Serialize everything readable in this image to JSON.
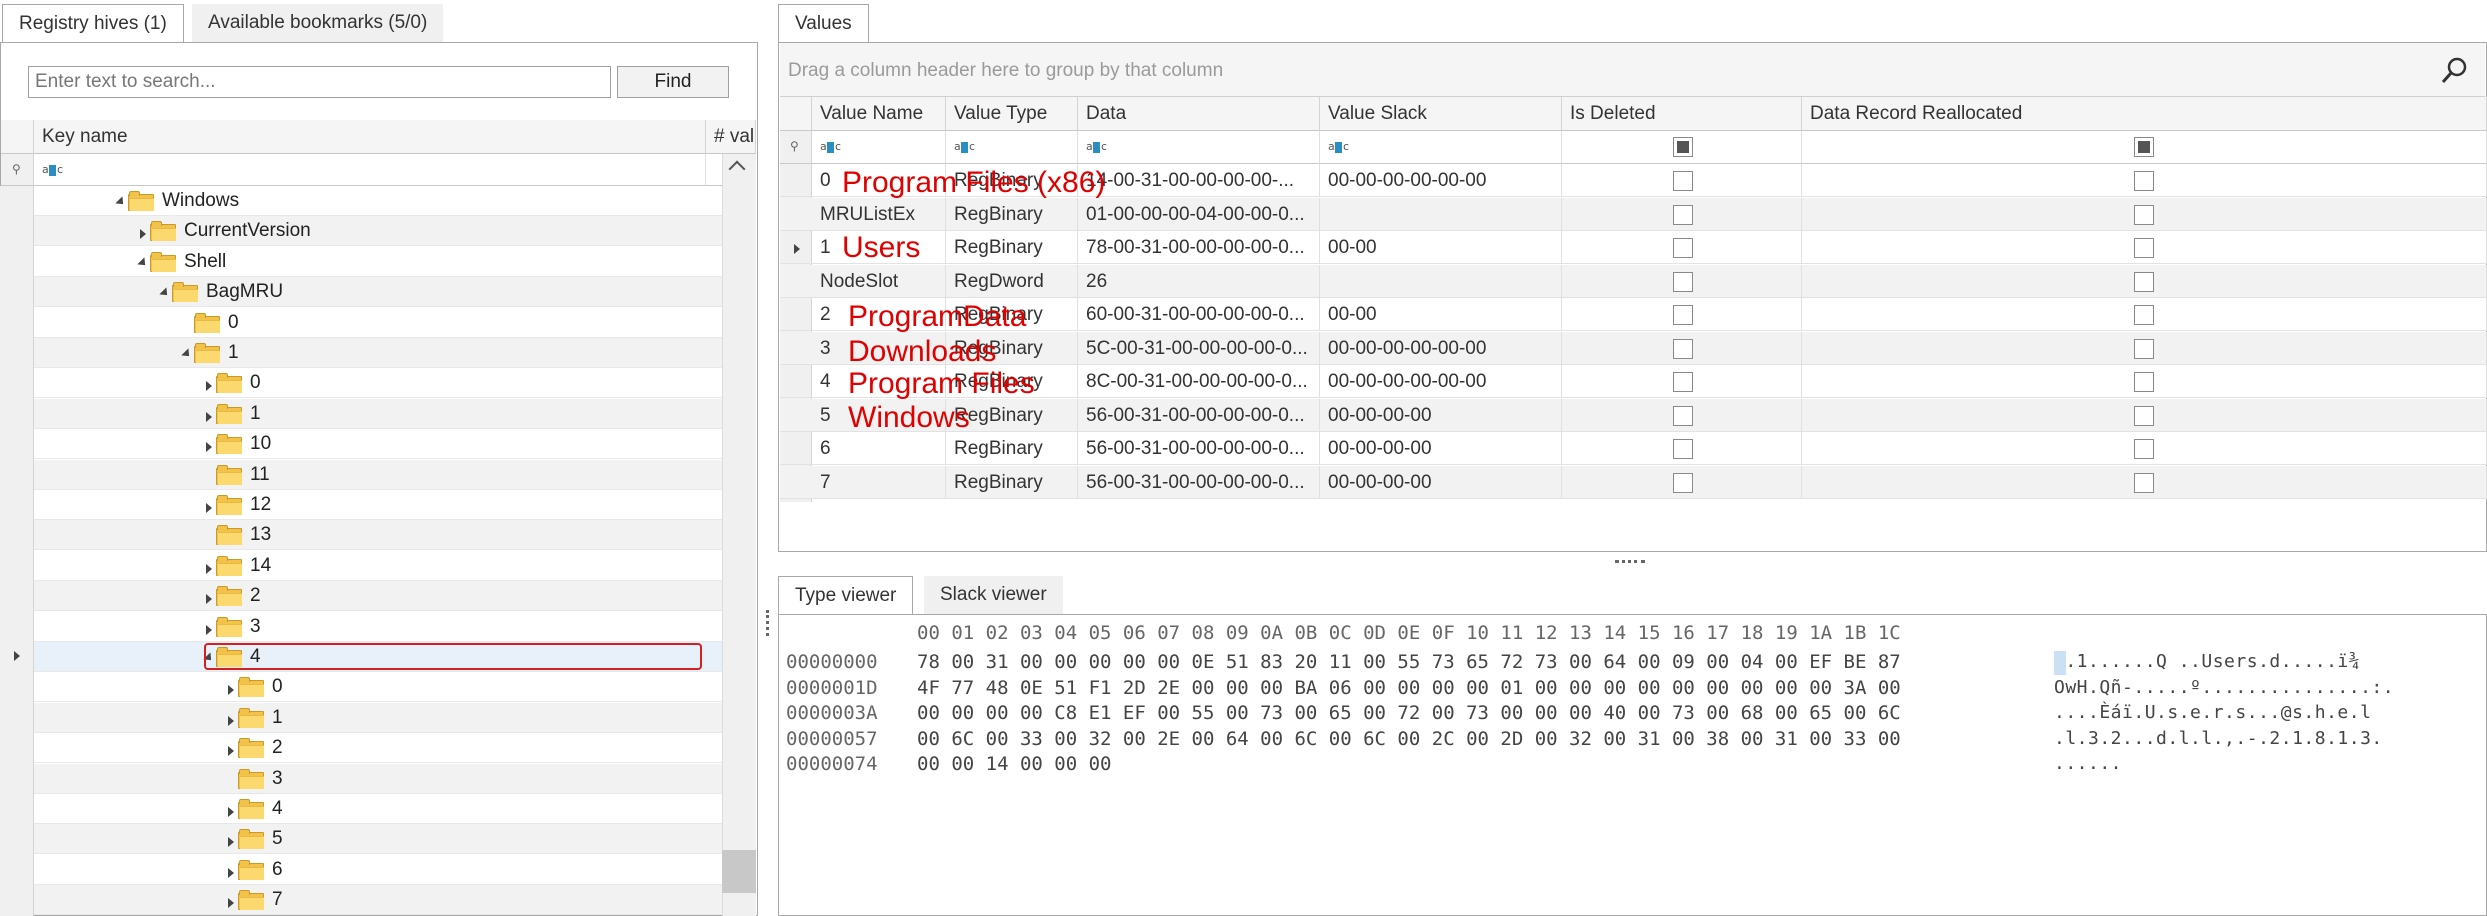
{
  "left_tabs": [
    "Registry hives (1)",
    "Available bookmarks (5/0)"
  ],
  "search": {
    "placeholder": "Enter text to search...",
    "find_label": "Find"
  },
  "tree_columns": {
    "key_name": "Key name",
    "values": "# val"
  },
  "tree_rows": [
    {
      "label": "Windows",
      "level": 0,
      "expander": "expanded"
    },
    {
      "label": "CurrentVersion",
      "level": 1,
      "expander": "collapsed"
    },
    {
      "label": "Shell",
      "level": 1,
      "expander": "expanded"
    },
    {
      "label": "BagMRU",
      "level": 2,
      "expander": "expanded"
    },
    {
      "label": "0",
      "level": 3,
      "expander": "none"
    },
    {
      "label": "1",
      "level": 3,
      "expander": "expanded"
    },
    {
      "label": "0",
      "level": 4,
      "expander": "collapsed"
    },
    {
      "label": "1",
      "level": 4,
      "expander": "collapsed"
    },
    {
      "label": "10",
      "level": 4,
      "expander": "collapsed"
    },
    {
      "label": "11",
      "level": 4,
      "expander": "none"
    },
    {
      "label": "12",
      "level": 4,
      "expander": "collapsed"
    },
    {
      "label": "13",
      "level": 4,
      "expander": "none"
    },
    {
      "label": "14",
      "level": 4,
      "expander": "collapsed"
    },
    {
      "label": "2",
      "level": 4,
      "expander": "collapsed"
    },
    {
      "label": "3",
      "level": 4,
      "expander": "collapsed"
    },
    {
      "label": "4",
      "level": 4,
      "expander": "expanded",
      "selected": true
    },
    {
      "label": "0",
      "level": 5,
      "expander": "collapsed"
    },
    {
      "label": "1",
      "level": 5,
      "expander": "collapsed"
    },
    {
      "label": "2",
      "level": 5,
      "expander": "collapsed"
    },
    {
      "label": "3",
      "level": 5,
      "expander": "none"
    },
    {
      "label": "4",
      "level": 5,
      "expander": "collapsed"
    },
    {
      "label": "5",
      "level": 5,
      "expander": "collapsed"
    },
    {
      "label": "6",
      "level": 5,
      "expander": "collapsed"
    },
    {
      "label": "7",
      "level": 5,
      "expander": "collapsed"
    }
  ],
  "values_tab": "Values",
  "group_hint": "Drag a column header here to group by that column",
  "value_columns": [
    "Value Name",
    "Value Type",
    "Data",
    "Value Slack",
    "Is Deleted",
    "Data Record Reallocated"
  ],
  "value_rows": [
    {
      "name": "0",
      "type": "RegBinary",
      "data": "14-00-31-00-00-00-00-...",
      "slack": "00-00-00-00-00-00"
    },
    {
      "name": "MRUListEx",
      "type": "RegBinary",
      "data": "01-00-00-00-04-00-00-0...",
      "slack": ""
    },
    {
      "name": "1",
      "type": "RegBinary",
      "data": "78-00-31-00-00-00-00-0...",
      "slack": "00-00"
    },
    {
      "name": "NodeSlot",
      "type": "RegDword",
      "data": "26",
      "slack": ""
    },
    {
      "name": "2",
      "type": "RegBinary",
      "data": "60-00-31-00-00-00-00-0...",
      "slack": "00-00"
    },
    {
      "name": "3",
      "type": "RegBinary",
      "data": "5C-00-31-00-00-00-00-0...",
      "slack": "00-00-00-00-00-00"
    },
    {
      "name": "4",
      "type": "RegBinary",
      "data": "8C-00-31-00-00-00-00-0...",
      "slack": "00-00-00-00-00-00"
    },
    {
      "name": "5",
      "type": "RegBinary",
      "data": "56-00-31-00-00-00-00-0...",
      "slack": "00-00-00-00"
    },
    {
      "name": "6",
      "type": "RegBinary",
      "data": "56-00-31-00-00-00-00-0...",
      "slack": "00-00-00-00"
    },
    {
      "name": "7",
      "type": "RegBinary",
      "data": "56-00-31-00-00-00-00-0...",
      "slack": "00-00-00-00"
    }
  ],
  "overlay_labels": [
    "Program Files (x86)",
    "Users",
    "ProgramData",
    "Downloads",
    "Program Files",
    "Windows"
  ],
  "bottom_tabs": [
    "Type viewer",
    "Slack viewer"
  ],
  "hex": {
    "header": "00 01 02 03 04 05 06 07 08 09 0A 0B 0C 0D 0E 0F 10 11 12 13 14 15 16 17 18 19 1A 1B 1C",
    "offsets": [
      "00000000",
      "0000001D",
      "0000003A",
      "00000057",
      "00000074"
    ],
    "bytes": [
      "78 00 31 00 00 00 00 00 0E 51 83 20 11 00 55 73 65 72 73 00 64 00 09 00 04 00 EF BE 87",
      "4F 77 48 0E 51 F1 2D 2E 00 00 00 BA 06 00 00 00 00 01 00 00 00 00 00 00 00 00 00 3A 00",
      "00 00 00 00 C8 E1 EF 00 55 00 73 00 65 00 72 00 73 00 00 00 40 00 73 00 68 00 65 00 6C",
      "00 6C 00 33 00 32 00 2E 00 64 00 6C 00 6C 00 2C 00 2D 00 32 00 31 00 38 00 31 00 33 00",
      "00 00 14 00 00 00"
    ],
    "ascii": [
      "x.1......Q ..Users.d.....ï¾",
      "OwH.Qñ-.....º...............:.",
      "....Èáï.U.s.e.r.s...@s.h.e.l",
      ".l.3.2...d.l.l.,.-.2.1.8.1.3.",
      "......"
    ]
  }
}
